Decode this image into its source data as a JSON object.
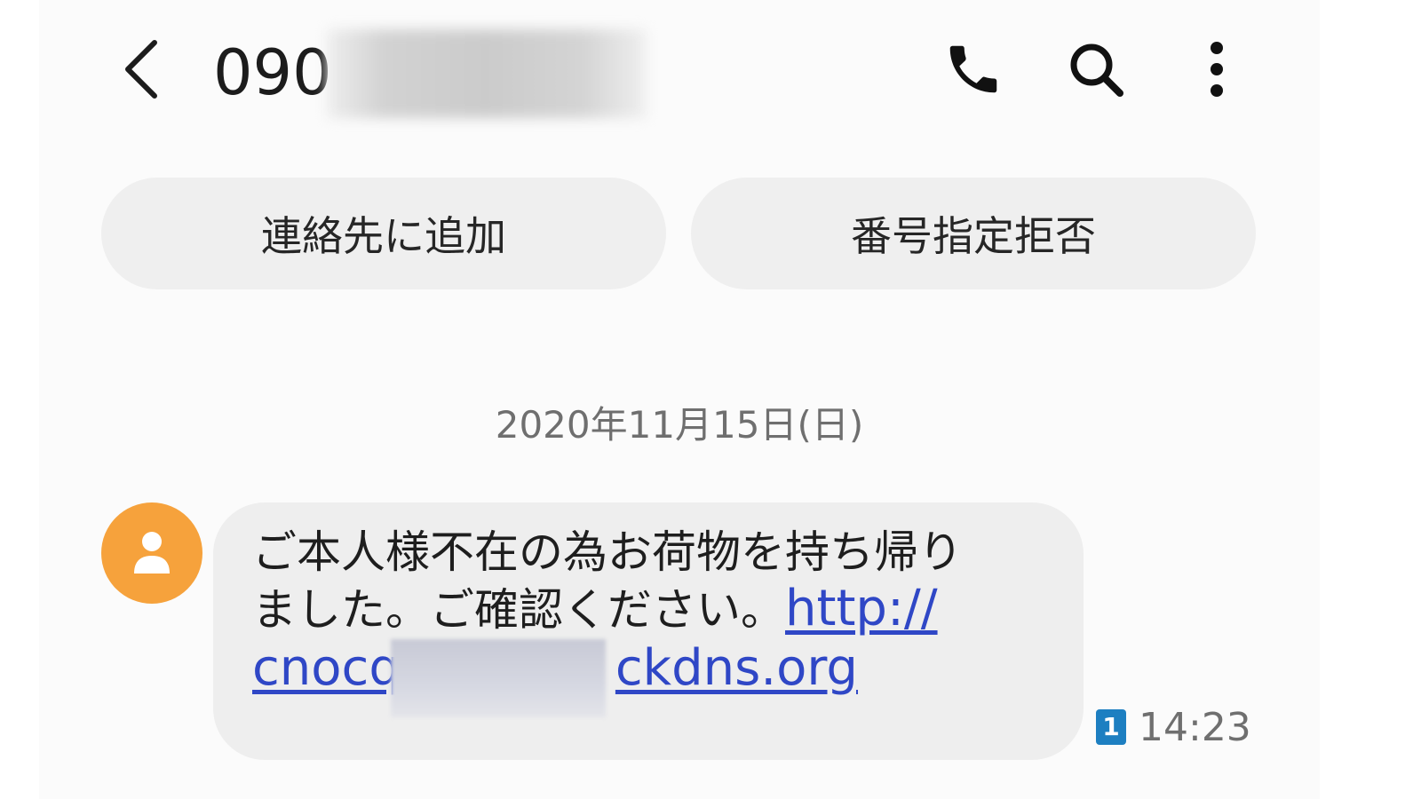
{
  "header": {
    "title_visible": "090",
    "back_icon": "chevron-left-icon",
    "call_icon": "phone-icon",
    "search_icon": "search-icon",
    "more_icon": "more-vertical-icon"
  },
  "actions": {
    "add_contact": "連絡先に追加",
    "block_number": "番号指定拒否"
  },
  "conversation": {
    "date_divider": "2020年11月15日(日)",
    "messages": [
      {
        "sender_avatar_icon": "person-icon",
        "avatar_color": "#f6a23c",
        "text_line1": "ご本人様不在の為お荷物を持ち帰り",
        "text_line2": "ました。ご確認ください。",
        "link_part1": "http://",
        "link_part2_start": "cnocq",
        "link_part2_end": "ckdns.org",
        "sim_badge": "1",
        "time": "14:23"
      }
    ]
  },
  "colors": {
    "link": "#2f47c6",
    "sim_badge": "#1d7fc1",
    "pill_bg": "#efefef",
    "bubble_bg": "#eeeeee"
  }
}
